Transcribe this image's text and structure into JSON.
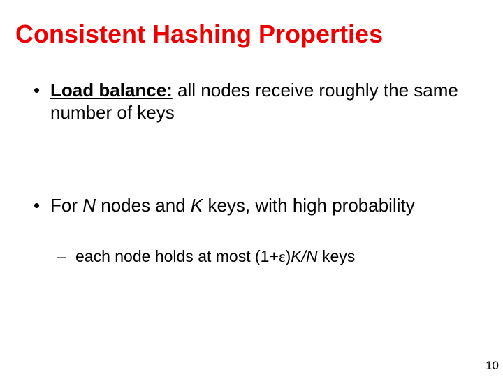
{
  "title": "Consistent Hashing Properties",
  "bullet1": {
    "label": "Load balance:",
    "rest": " all nodes receive roughly the same number of keys"
  },
  "bullet2": {
    "pre": "For ",
    "N": "N",
    "mid1": " nodes and ",
    "K": "K",
    "post": " keys, with high probability"
  },
  "sub": {
    "pre": "each node holds at most (1+",
    "eps": "ε",
    "mid": ")",
    "kn": "K/N",
    "post": " keys"
  },
  "page_number": "10"
}
